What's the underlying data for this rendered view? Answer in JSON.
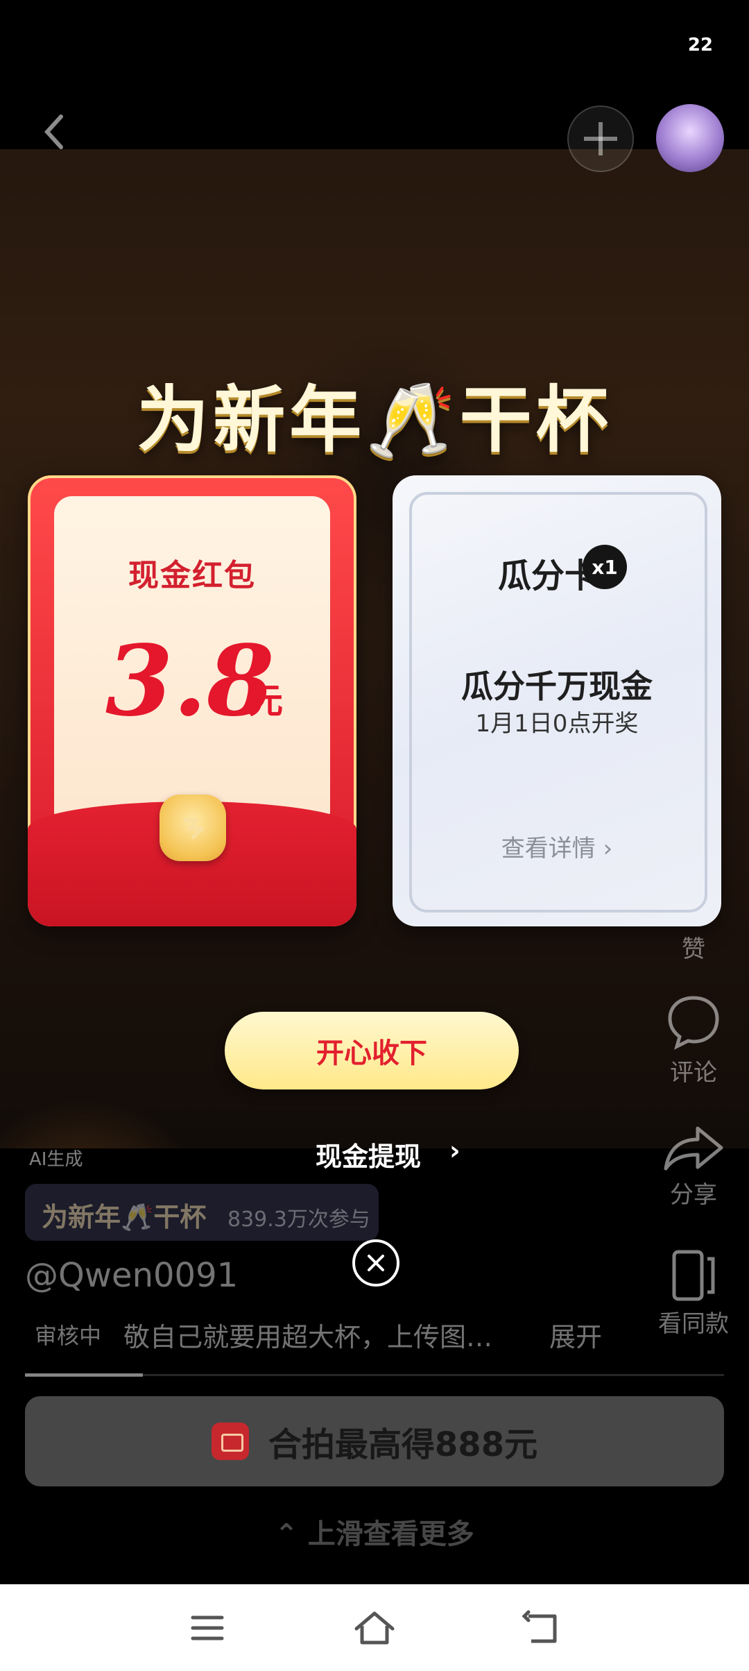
{
  "status_bar": {
    "time": "22"
  },
  "banner": {
    "title": "为新年🥂干杯"
  },
  "red_packet": {
    "title": "现金红包",
    "amount": "3.8",
    "unit": "元"
  },
  "share_card": {
    "title": "瓜分卡",
    "badge": "x1",
    "main_text": "瓜分千万现金",
    "sub_text": "1月1日0点开奖",
    "detail_link": "查看详情 ›"
  },
  "accept_button": "开心收下",
  "withdraw_link": "现金提现",
  "post": {
    "ai_tag": "AI生成",
    "topic_title": "为新年🥂干杯",
    "topic_count": "839.3万次参与",
    "username": "@Qwen0091",
    "review_tag": "审核中",
    "description": "敬自己就要用超大杯，上传图…",
    "expand": "展开"
  },
  "side_actions": {
    "like": "赞",
    "comment": "评论",
    "share": "分享",
    "same_style": "看同款"
  },
  "cta_button": "合拍最高得888元",
  "swipe_hint": "上滑查看更多",
  "icons": [
    "back-icon",
    "plus-icon",
    "avatar",
    "close-icon",
    "comment-icon",
    "share-icon",
    "same-style-icon",
    "menu-icon",
    "home-icon",
    "back-nav-icon"
  ]
}
